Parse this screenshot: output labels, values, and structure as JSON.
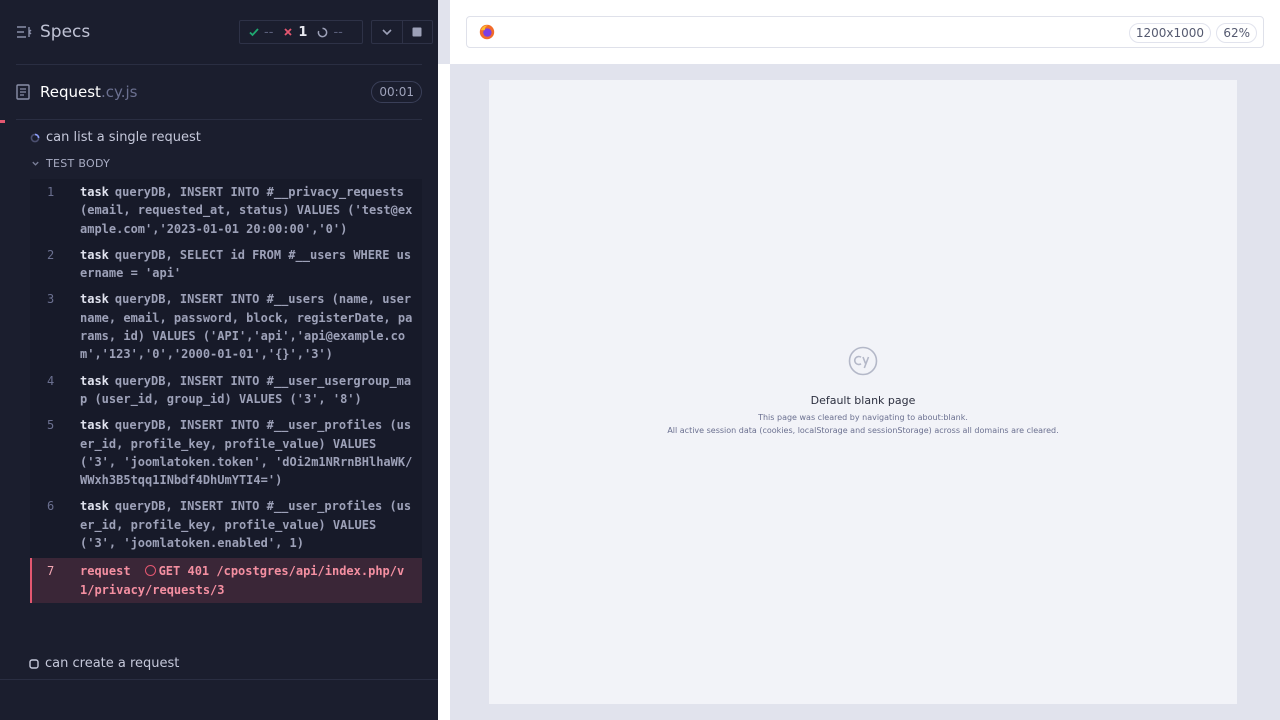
{
  "header": {
    "specs_label": "Specs",
    "stats": {
      "passed": "--",
      "failed": "1",
      "pending": "--"
    }
  },
  "spec": {
    "name": "Request",
    "ext": ".cy.js",
    "duration": "00:01"
  },
  "tests": [
    {
      "title": "can list a single request",
      "section": "TEST BODY",
      "commands": [
        {
          "num": "1",
          "name": "task",
          "message": "queryDB, INSERT INTO #__privacy_requests (email, requested_at, status) VALUES ('test@example.com','2023-01-01 20:00:00','0')"
        },
        {
          "num": "2",
          "name": "task",
          "message": "queryDB, SELECT id FROM #__users WHERE username = 'api'"
        },
        {
          "num": "3",
          "name": "task",
          "message": "queryDB, INSERT INTO #__users (name, username, email, password, block, registerDate, params, id) VALUES ('API','api','api@example.com','123','0','2000-01-01','{}','3')"
        },
        {
          "num": "4",
          "name": "task",
          "message": "queryDB, INSERT INTO #__user_usergroup_map (user_id, group_id) VALUES ('3', '8')"
        },
        {
          "num": "5",
          "name": "task",
          "message": "queryDB, INSERT INTO #__user_profiles (user_id, profile_key, profile_value) VALUES ('3', 'joomlatoken.token', 'dOi2m1NRrnBHlhaWK/WWxh3B5tqq1INbdf4DhUmYTI4=')"
        },
        {
          "num": "6",
          "name": "task",
          "message": "queryDB, INSERT INTO #__user_profiles (user_id, profile_key, profile_value) VALUES ('3', 'joomlatoken.enabled', 1)"
        },
        {
          "num": "7",
          "name": "request",
          "message": "GET 401 /cpostgres/api/index.php/v1/privacy/requests/3",
          "status": "failed"
        }
      ]
    },
    {
      "title": "can create a request"
    }
  ],
  "aut": {
    "viewport": "1200x1000",
    "zoom": "62%",
    "blank_title": "Default blank page",
    "blank_line1": "This page was cleared by navigating to about:blank.",
    "blank_line2": "All active session data (cookies, localStorage and sessionStorage) across all domains are cleared."
  },
  "colors": {
    "panel_bg": "#1b1e2e",
    "accent_fail": "#e45770",
    "pass": "#1fa971"
  },
  "icons": [
    "specs-menu-icon",
    "check-icon",
    "x-icon",
    "pending-icon",
    "chevron-down-icon",
    "stop-icon",
    "file-icon",
    "spinner-icon",
    "firefox-icon",
    "cypress-logo-icon"
  ]
}
